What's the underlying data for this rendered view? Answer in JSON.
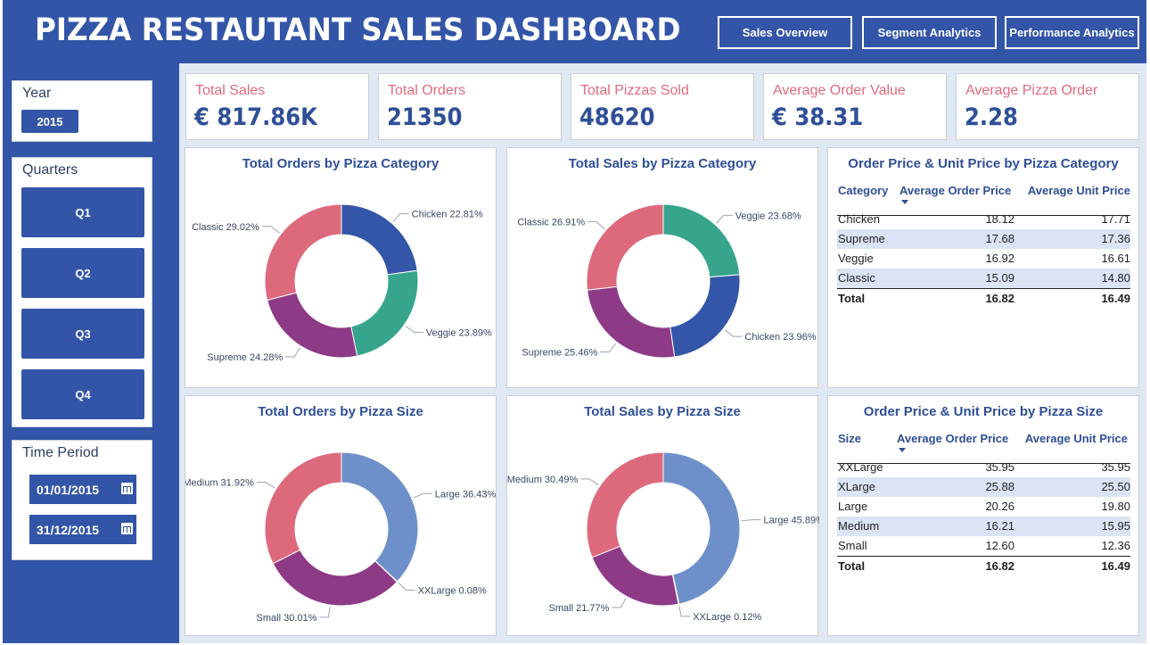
{
  "header": {
    "title": "PIZZA RESTAUTANT SALES DASHBOARD",
    "nav": [
      "Sales Overview",
      "Segment Analytics",
      "Performance Analytics"
    ]
  },
  "sidebar": {
    "year": {
      "title": "Year",
      "value": "2015"
    },
    "quarters": {
      "title": "Quarters",
      "items": [
        "Q1",
        "Q2",
        "Q3",
        "Q4"
      ]
    },
    "time_period": {
      "title": "Time Period",
      "start": "01/01/2015",
      "end": "31/12/2015"
    }
  },
  "kpis": [
    {
      "label": "Total Sales",
      "value": "€ 817.86K"
    },
    {
      "label": "Total Orders",
      "value": "21350"
    },
    {
      "label": "Total Pizzas Sold",
      "value": "48620"
    },
    {
      "label": "Average Order Value",
      "value": "€ 38.31"
    },
    {
      "label": "Average Pizza Order",
      "value": "2.28"
    }
  ],
  "colors": {
    "brand": "#3355a8",
    "kpi_label": "#e06a7d",
    "kpi_value": "#2f4f96",
    "chicken": "#3356a8",
    "veggie": "#37a58c",
    "supreme": "#8e3a86",
    "classic": "#dd6a7c",
    "large": "#6e90ca",
    "xxlarge": "#37a58c",
    "small": "#8e3a86",
    "medium": "#dd6a7c"
  },
  "chart_data": [
    {
      "type": "pie",
      "title": "Total Orders by Pizza Category",
      "slices": [
        {
          "name": "Chicken",
          "value": 22.81,
          "label": "Chicken 22.81%",
          "color": "#3356a8"
        },
        {
          "name": "Veggie",
          "value": 23.89,
          "label": "Veggie 23.89%",
          "color": "#37a58c"
        },
        {
          "name": "Supreme",
          "value": 24.28,
          "label": "Supreme 24.28%",
          "color": "#8e3a86"
        },
        {
          "name": "Classic",
          "value": 29.02,
          "label": "Classic 29.02%",
          "color": "#dd6a7c"
        }
      ]
    },
    {
      "type": "pie",
      "title": "Total Sales by Pizza Category",
      "slices": [
        {
          "name": "Veggie",
          "value": 23.68,
          "label": "Veggie 23.68%",
          "color": "#37a58c"
        },
        {
          "name": "Chicken",
          "value": 23.96,
          "label": "Chicken 23.96%",
          "color": "#3356a8"
        },
        {
          "name": "Supreme",
          "value": 25.46,
          "label": "Supreme 25.46%",
          "color": "#8e3a86"
        },
        {
          "name": "Classic",
          "value": 26.91,
          "label": "Classic 26.91%",
          "color": "#dd6a7c"
        }
      ]
    },
    {
      "type": "pie",
      "title": "Total Orders by Pizza Size",
      "slices": [
        {
          "name": "Large",
          "value": 36.43,
          "label": "Large 36.43%",
          "color": "#6e90ca"
        },
        {
          "name": "XXLarge",
          "value": 0.08,
          "label": "XXLarge 0.08%",
          "color": "#37a58c"
        },
        {
          "name": "Small",
          "value": 30.01,
          "label": "Small 30.01%",
          "color": "#8e3a86"
        },
        {
          "name": "Medium",
          "value": 31.92,
          "label": "Medium 31.92%",
          "color": "#dd6a7c"
        }
      ]
    },
    {
      "type": "pie",
      "title": "Total Sales by Pizza Size",
      "slices": [
        {
          "name": "Large",
          "value": 45.89,
          "label": "Large 45.89%",
          "color": "#6e90ca"
        },
        {
          "name": "XXLarge",
          "value": 0.12,
          "label": "XXLarge 0.12%",
          "color": "#37a58c"
        },
        {
          "name": "Small",
          "value": 21.77,
          "label": "Small 21.77%",
          "color": "#8e3a86"
        },
        {
          "name": "Medium",
          "value": 30.49,
          "label": "Medium 30.49%",
          "color": "#dd6a7c"
        }
      ]
    },
    {
      "type": "table",
      "title": "Order Price & Unit Price by Pizza Category",
      "columns": [
        "Category",
        "Average Order Price",
        "Average Unit Price"
      ],
      "rows": [
        [
          "Chicken",
          "18.12",
          "17.71"
        ],
        [
          "Supreme",
          "17.68",
          "17.36"
        ],
        [
          "Veggie",
          "16.92",
          "16.61"
        ],
        [
          "Classic",
          "15.09",
          "14.80"
        ]
      ],
      "total": [
        "Total",
        "16.82",
        "16.49"
      ]
    },
    {
      "type": "table",
      "title": "Order Price & Unit Price by Pizza Size",
      "columns": [
        "Size",
        "Average Order Price",
        "Average Unit Price"
      ],
      "rows": [
        [
          "XXLarge",
          "35.95",
          "35.95"
        ],
        [
          "XLarge",
          "25.88",
          "25.50"
        ],
        [
          "Large",
          "20.26",
          "19.80"
        ],
        [
          "Medium",
          "16.21",
          "15.95"
        ],
        [
          "Small",
          "12.60",
          "12.36"
        ]
      ],
      "total": [
        "Total",
        "16.82",
        "16.49"
      ]
    }
  ]
}
